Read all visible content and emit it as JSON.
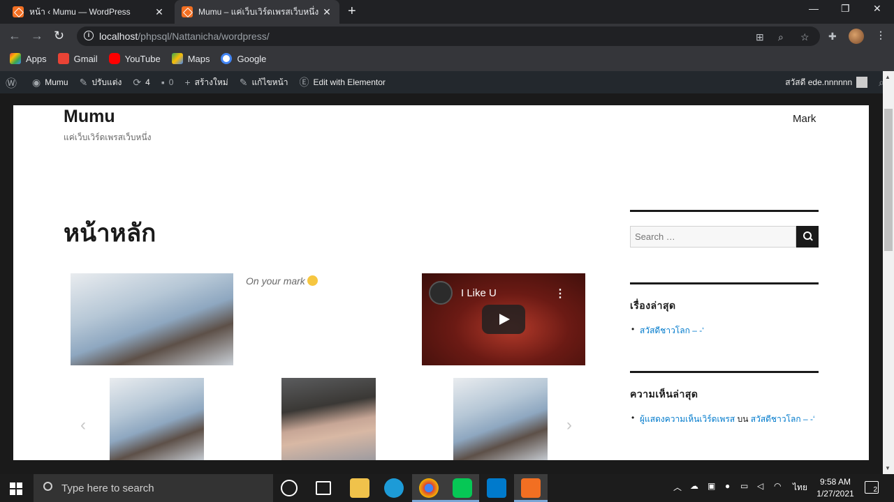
{
  "browser": {
    "tabs": [
      {
        "title": "หน้า ‹ Mumu — WordPress",
        "close": "✕"
      },
      {
        "title": "Mumu – แค่เว็บเวิร์ดเพรสเว็บหนึ่ง",
        "close": "✕"
      }
    ],
    "new_tab": "+",
    "window_controls": {
      "minimize": "—",
      "restore": "❐",
      "close": "✕"
    },
    "url_host": "localhost",
    "url_path": "/phpsql/Nattanicha/wordpress/",
    "bookmarks": [
      {
        "label": "Apps",
        "icon": "apps-grid-icon",
        "color": "#e8453c"
      },
      {
        "label": "Gmail",
        "icon": "gmail-icon",
        "color": "#ea4335"
      },
      {
        "label": "YouTube",
        "icon": "youtube-icon",
        "color": "#ff0000"
      },
      {
        "label": "Maps",
        "icon": "maps-icon",
        "color": "#34a853"
      },
      {
        "label": "Google",
        "icon": "google-icon",
        "color": "#4285f4"
      }
    ]
  },
  "adminbar": {
    "site_name": "Mumu",
    "customize": "ปรับแต่ง",
    "updates_count": "4",
    "comments_count": "0",
    "new": "สร้างใหม่",
    "edit_page": "แก้ไขหน้า",
    "elementor": "Edit with Elementor",
    "greeting": "สวัสดี ede.nnnnnn"
  },
  "site": {
    "title": "Mumu",
    "description": "แค่เว็บเวิร์ดเพรสเว็บหนึ่ง",
    "nav_item": "Mark",
    "page_title": "หน้าหลัก",
    "caption": "On your mark",
    "video_title": "I Like U",
    "carousel_prev": "‹",
    "carousel_next": "›"
  },
  "sidebar": {
    "search_placeholder": "Search …",
    "recent_posts_title": "เรื่องล่าสุด",
    "recent_posts": [
      "สวัสดีชาวโลก – -‘"
    ],
    "recent_comments_title": "ความเห็นล่าสุด",
    "comment_author": "ผู้แสดงความเห็นเวิร์ดเพรส",
    "comment_on": "บน",
    "comment_post": "สวัสดีชาวโลก – -‘"
  },
  "taskbar": {
    "search_placeholder": "Type here to search",
    "time": "9:58 AM",
    "date": "1/27/2021",
    "language": "ไทย",
    "notifications": "2"
  }
}
